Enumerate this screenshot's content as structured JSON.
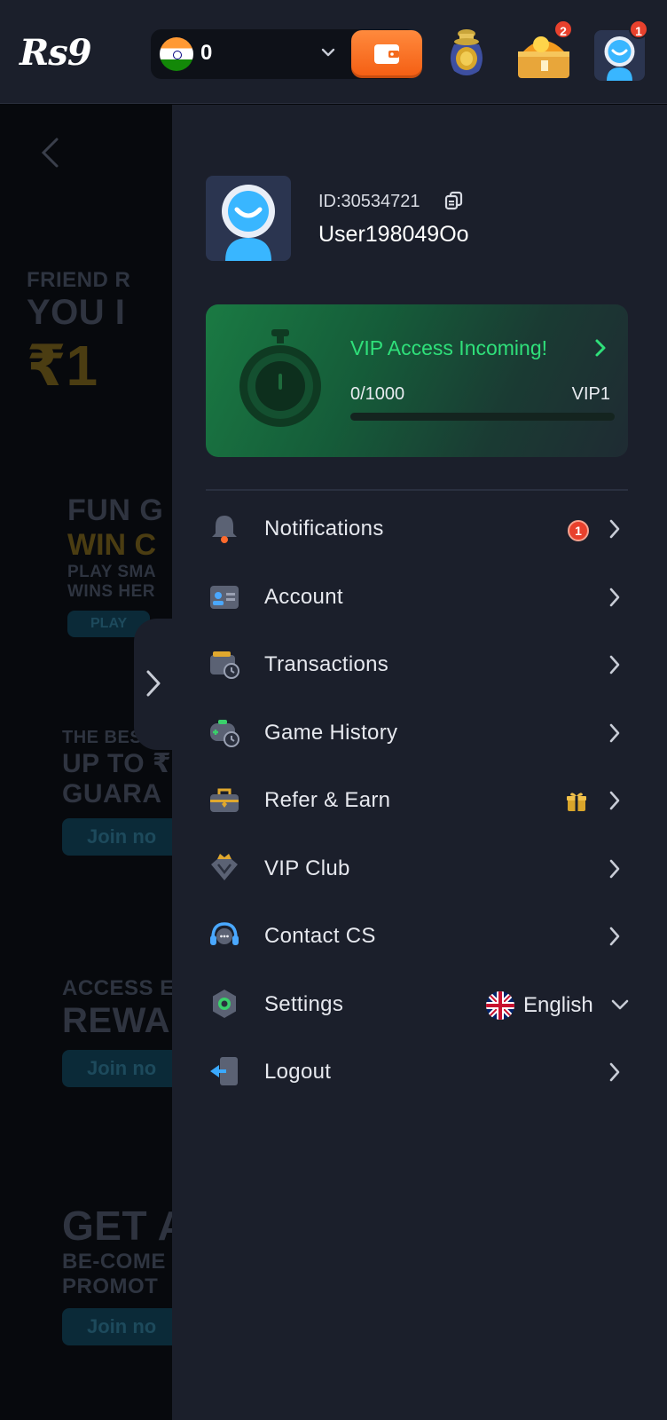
{
  "header": {
    "logo": "Rs9",
    "balance": "0",
    "chest_badge": "2",
    "avatar_badge": "1"
  },
  "profile": {
    "id": "ID:30534721",
    "username": "User198049Oo"
  },
  "vip": {
    "title": "VIP Access Incoming!",
    "progress_text": "0/1000",
    "level": "VIP1",
    "progress_fraction": 0,
    "accent_color": "#2fe07a"
  },
  "menu": {
    "items": [
      {
        "label": "Notifications",
        "icon": "bell-icon",
        "badge": "1"
      },
      {
        "label": "Account",
        "icon": "id-card-icon"
      },
      {
        "label": "Transactions",
        "icon": "wallet-clock-icon"
      },
      {
        "label": "Game History",
        "icon": "gamepad-clock-icon"
      },
      {
        "label": "Refer & Earn",
        "icon": "briefcase-icon",
        "extra_icon": "gift-icon"
      },
      {
        "label": "VIP Club",
        "icon": "crown-gem-icon"
      },
      {
        "label": "Contact CS",
        "icon": "headset-icon"
      },
      {
        "label": "Settings",
        "icon": "gear-icon",
        "language": "English"
      },
      {
        "label": "Logout",
        "icon": "logout-icon"
      }
    ]
  },
  "background_page": {
    "promo1_small": "FRIEND R",
    "promo1_big": "YOU I",
    "promo1_gold": "₹1",
    "promo2_big": "FUN G",
    "promo2_gold": "WIN C",
    "promo2_small1": "PLAY SMA",
    "promo2_small2": "WINS HER",
    "promo2_btn": "PLAY",
    "promo3_small": "THE BEST",
    "promo3_big1": "UP TO ₹",
    "promo3_big2": "GUARA",
    "promo3_btn": "Join no",
    "promo4_small": "ACCESS E",
    "promo4_big": "REWA",
    "promo4_btn": "Join no",
    "promo5_big": "GET A",
    "promo5_small1": "BE-COME",
    "promo5_small2": "PROMOT",
    "promo5_btn": "Join no"
  }
}
